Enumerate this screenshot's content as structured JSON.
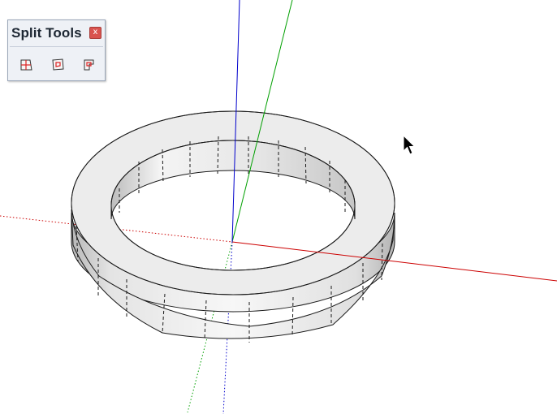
{
  "toolbar": {
    "title": "Split Tools",
    "close_glyph": "x",
    "tools": [
      {
        "icon": "split-edge-icon"
      },
      {
        "icon": "split-face-icon"
      },
      {
        "icon": "split-region-icon"
      }
    ]
  },
  "scene": {
    "axis_colors": {
      "x": "#cc0000",
      "y": "#00a000",
      "z": "#0000cc"
    },
    "ring_fill": "#ececec",
    "ring_shade": "#c9c9c9"
  }
}
